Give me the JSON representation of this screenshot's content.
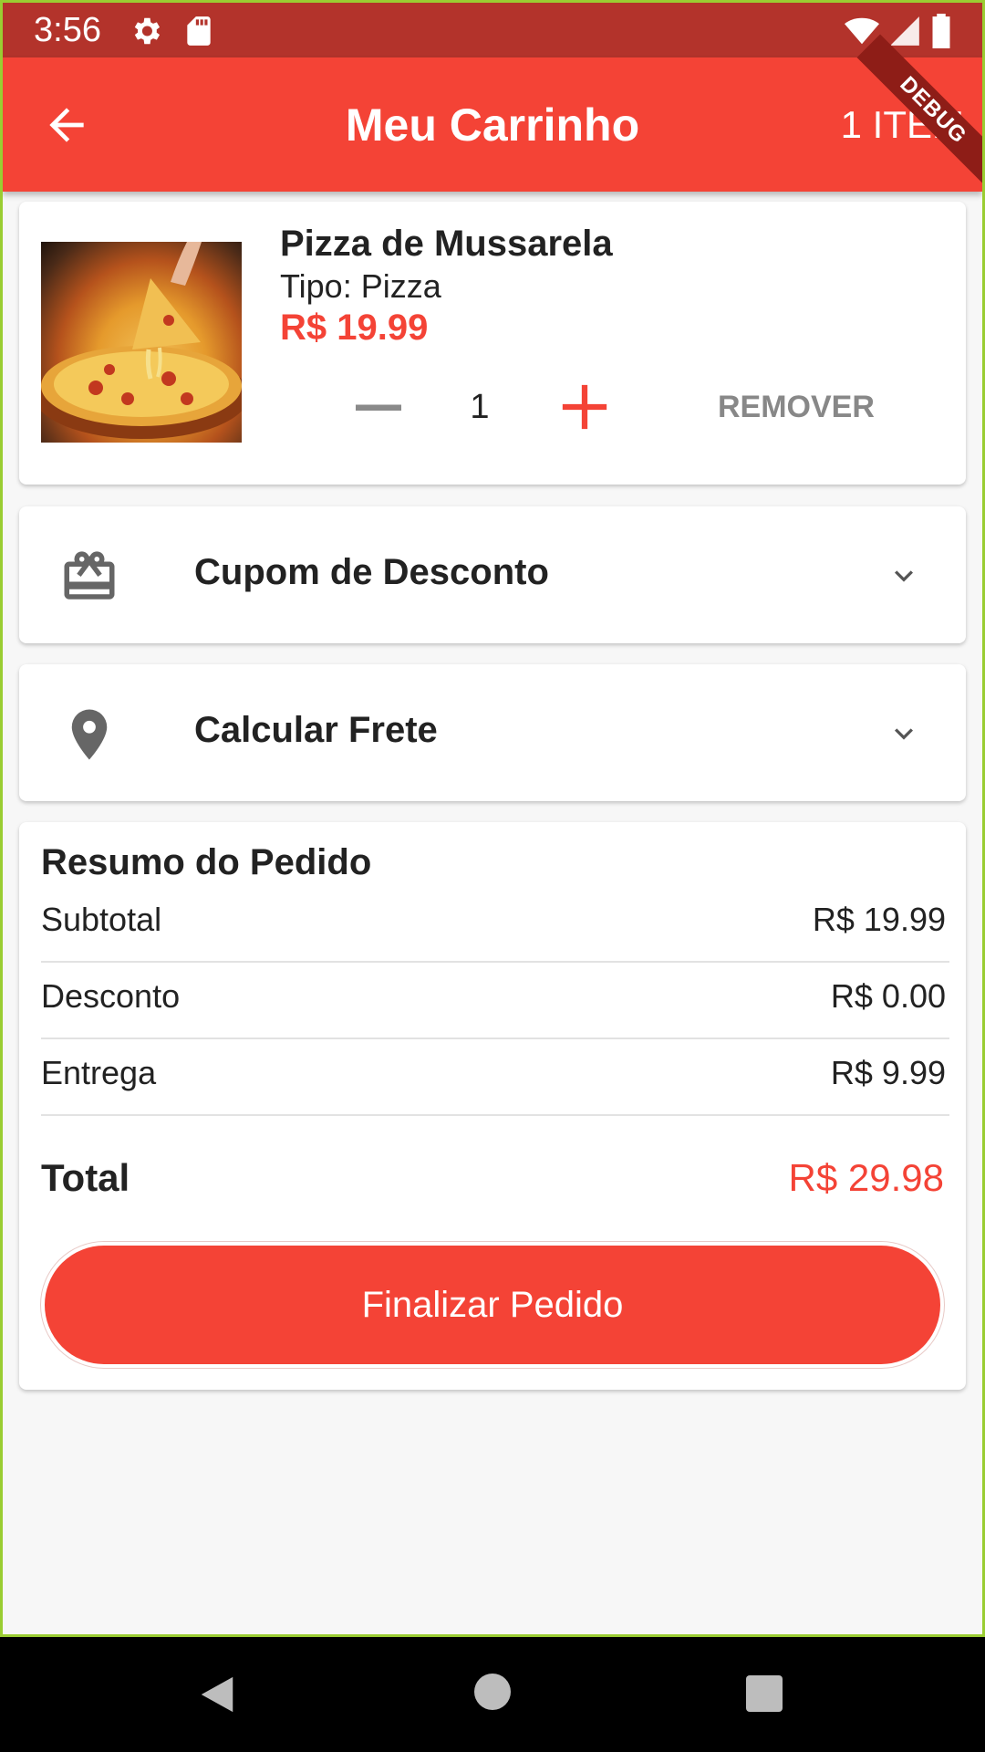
{
  "status_bar": {
    "time": "3:56",
    "icons": [
      "settings-icon",
      "sd-card-icon",
      "wifi-icon",
      "signal-icon",
      "battery-icon"
    ]
  },
  "app_bar": {
    "title": "Meu Carrinho",
    "item_count": "1 ITEM",
    "debug_label": "DEBUG",
    "back_icon": "arrow-back-icon",
    "color": "#f44336"
  },
  "cart_item": {
    "name": "Pizza de Mussarela",
    "type_label": "Tipo: Pizza",
    "price": "R$ 19.99",
    "quantity": "1",
    "remove_label": "REMOVER"
  },
  "coupon": {
    "label": "Cupom de Desconto",
    "icon": "gift-card-icon"
  },
  "shipping": {
    "label": "Calcular Frete",
    "icon": "location-pin-icon"
  },
  "summary": {
    "title": "Resumo do Pedido",
    "subtotal_label": "Subtotal",
    "subtotal_value": "R$ 19.99",
    "discount_label": "Desconto",
    "discount_value": "R$ 0.00",
    "delivery_label": "Entrega",
    "delivery_value": "R$ 9.99",
    "total_label": "Total",
    "total_value": "R$ 29.98",
    "checkout_label": "Finalizar Pedido"
  },
  "colors": {
    "primary": "#f44336",
    "status_bar": "#b3332b",
    "accent_text": "#f44336"
  }
}
